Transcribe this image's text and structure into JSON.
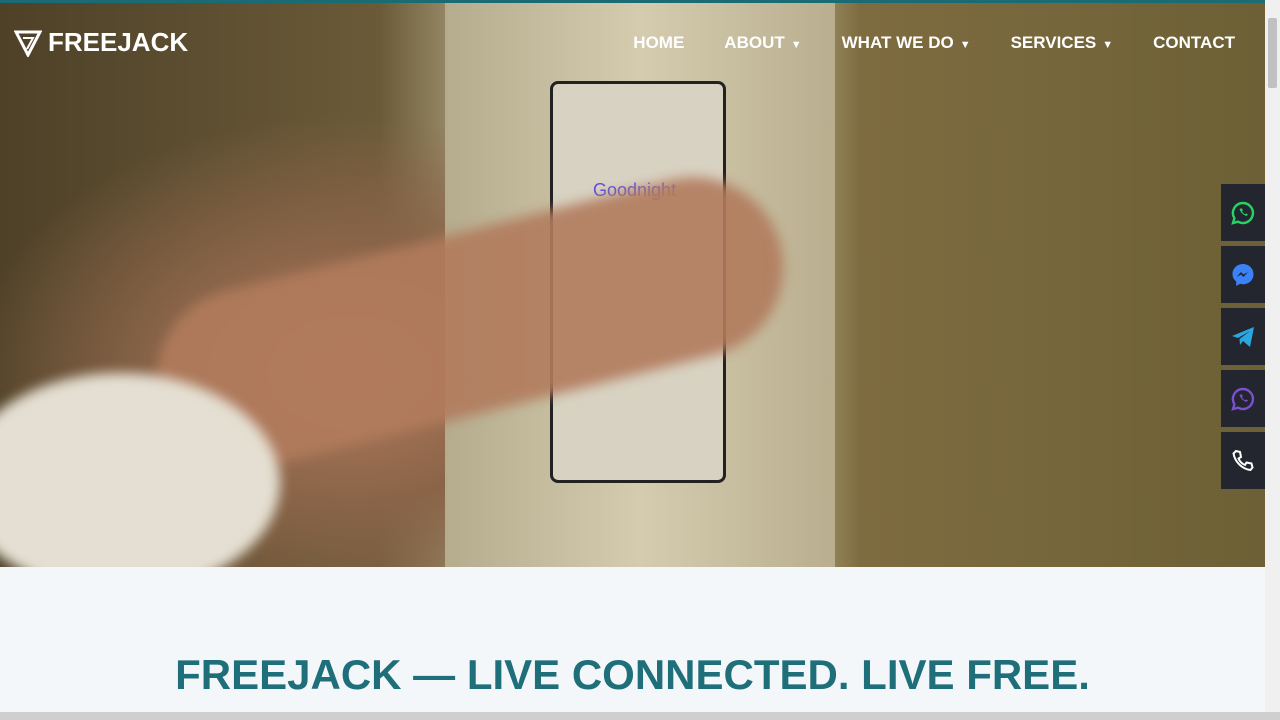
{
  "brand": {
    "name": "FREEJACK",
    "accent": "#1f6f7a"
  },
  "nav": {
    "items": [
      {
        "label": "HOME",
        "dropdown": false
      },
      {
        "label": "ABOUT",
        "dropdown": true
      },
      {
        "label": "WHAT WE DO",
        "dropdown": true
      },
      {
        "label": "SERVICES",
        "dropdown": true
      },
      {
        "label": "CONTACT",
        "dropdown": false
      }
    ]
  },
  "hero": {
    "switch_label": "Goodnight"
  },
  "floating_contacts": [
    {
      "icon": "whatsapp-icon",
      "color": "#25d366"
    },
    {
      "icon": "messenger-icon",
      "color": "#3b82f6"
    },
    {
      "icon": "telegram-icon",
      "color": "#2aa7e0"
    },
    {
      "icon": "viber-icon",
      "color": "#7b4fd0"
    },
    {
      "icon": "phone-icon",
      "color": "#ffffff"
    }
  ],
  "main": {
    "headline": "FREEJACK — LIVE CONNECTED. LIVE FREE."
  }
}
